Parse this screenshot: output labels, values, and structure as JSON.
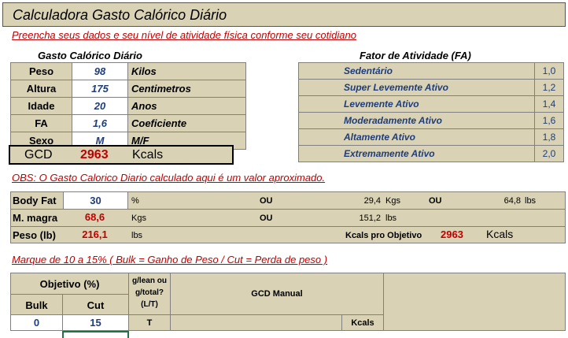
{
  "title": "Calculadora Gasto Calórico Diário",
  "subtitle": "Preencha seus dados e seu nível de atividade física conforme seu cotidiano",
  "gcd_section": {
    "heading": "Gasto Calórico Diário",
    "rows": [
      {
        "label": "Peso",
        "value": "98",
        "unit": "Kilos"
      },
      {
        "label": "Altura",
        "value": "175",
        "unit": "Centimetros"
      },
      {
        "label": "Idade",
        "value": "20",
        "unit": "Anos"
      },
      {
        "label": "FA",
        "value": "1,6",
        "unit": "Coeficiente"
      },
      {
        "label": "Sexo",
        "value": "M",
        "unit": "M/F"
      }
    ],
    "gcd_label": "GCD",
    "gcd_value": "2963",
    "gcd_unit": "Kcals"
  },
  "fa_section": {
    "heading": "Fator de Atividade (FA)",
    "rows": [
      {
        "name": "Sedentário",
        "value": "1,0"
      },
      {
        "name": "Super Levemente Ativo",
        "value": "1,2"
      },
      {
        "name": "Levemente Ativo",
        "value": "1,4"
      },
      {
        "name": "Moderadamente Ativo",
        "value": "1,6"
      },
      {
        "name": "Altamente Ativo",
        "value": "1,8"
      },
      {
        "name": "Extremamente Ativo",
        "value": "2,0"
      }
    ]
  },
  "obs": "OBS: O Gasto Calorico Diario calculado aqui é um valor aproximado.",
  "body": {
    "body_fat_label": "Body Fat",
    "body_fat_value": "30",
    "body_fat_unit": "%",
    "ou1": "OU",
    "fat_kg": "29,4",
    "kgs_unit": "Kgs",
    "ou2": "OU",
    "fat_lbs": "64,8",
    "lbs_unit": "lbs",
    "mmagra_label": "M. magra",
    "mmagra_value": "68,6",
    "mmagra_unit": "Kgs",
    "ou3": "OU",
    "mmagra_lbs": "151,2",
    "mmagra_lbs_unit": "lbs",
    "peso_lb_label": "Peso (lb)",
    "peso_lb_value": "216,1",
    "peso_lb_unit": "lbs",
    "kcals_objetivo_label": "Kcals pro Objetivo",
    "kcals_objetivo_value": "2963",
    "kcals_objetivo_unit": "Kcals"
  },
  "marque": "Marque de 10 a 15% ( Bulk = Ganho de Peso / Cut = Perda de peso )",
  "objetivo": {
    "heading": "Objetivo (%)",
    "bulk_label": "Bulk",
    "cut_label": "Cut",
    "bulk_value": "0",
    "cut_value": "15",
    "glean_header": "g/lean ou g/total? (L/T)",
    "glean_value": "T",
    "gcd_manual_label": "GCD Manual",
    "gcd_manual_unit": "Kcals"
  }
}
